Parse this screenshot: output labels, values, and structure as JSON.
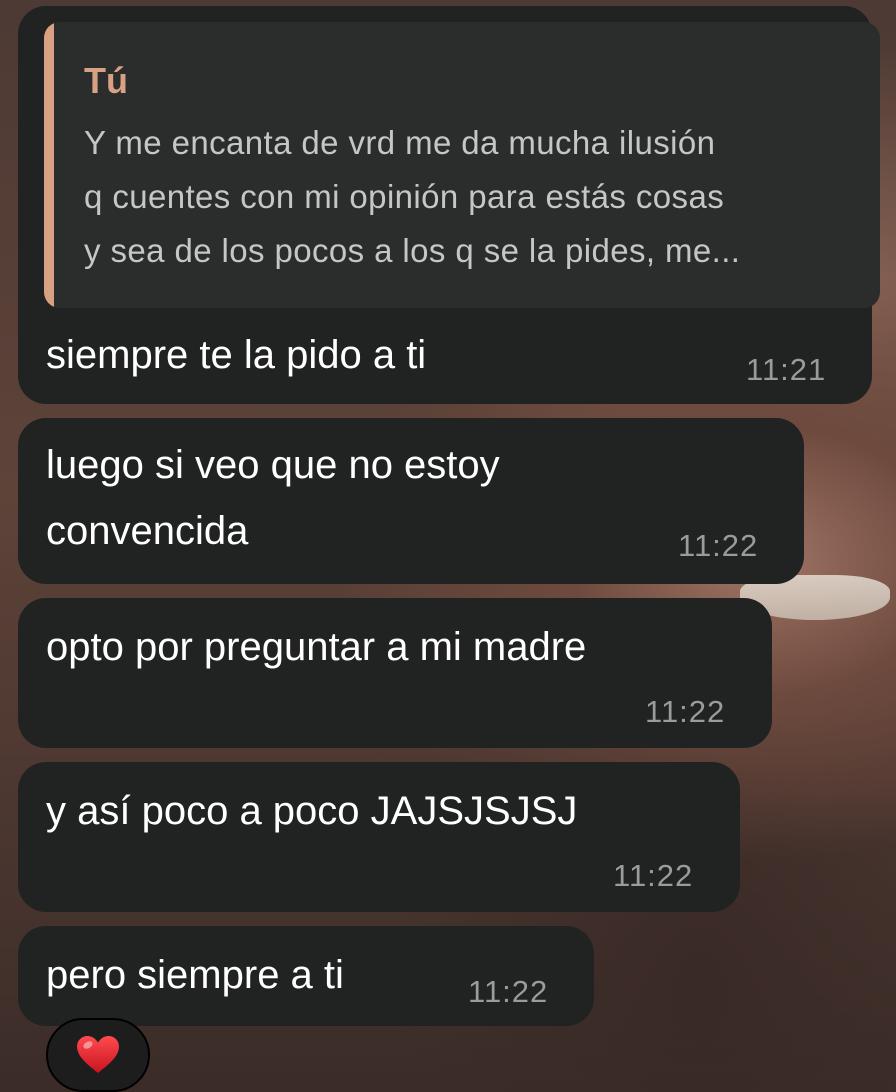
{
  "colors": {
    "bubble": "#212222",
    "reply_background": "#2b2c2c",
    "reply_accent": "#d9a183",
    "message_text": "#ffffff",
    "timestamp": "#9a9b9b",
    "reaction_heart": "#e0242e"
  },
  "messages": [
    {
      "reply_to": {
        "author": "Tú",
        "text": "Y me encanta de vrd me da mucha ilusión\nq cuentes con mi opinión para estás cosas\ny sea de los pocos a los q se la pides, me..."
      },
      "text": "siempre te la pido a ti",
      "time": "11:21"
    },
    {
      "text": "luego si veo que no estoy\nconvencida",
      "time": "11:22"
    },
    {
      "text": "opto por preguntar a mi madre",
      "time": "11:22"
    },
    {
      "text": "y así poco a poco JAJSJSJSJ",
      "time": "11:22"
    },
    {
      "text": "pero siempre a ti",
      "time": "11:22",
      "reaction": {
        "icon": "red-heart-icon"
      }
    }
  ]
}
